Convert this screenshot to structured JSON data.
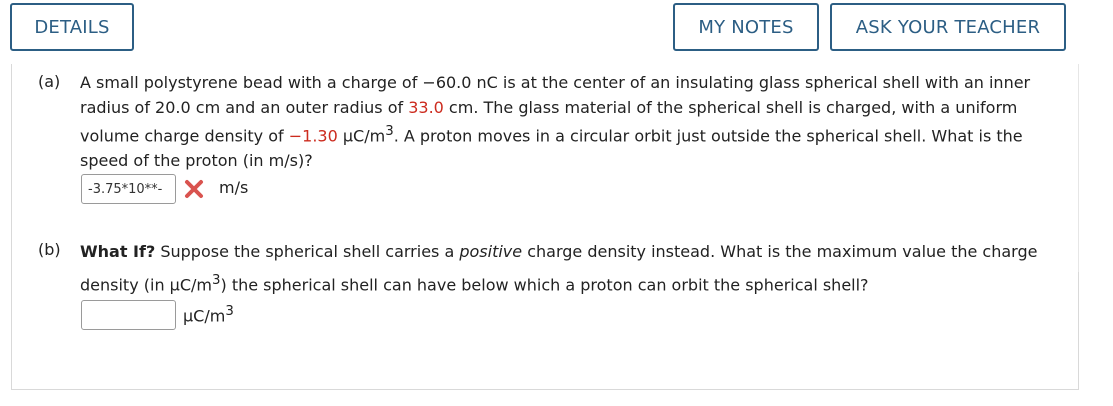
{
  "header": {
    "details_label": "DETAILS",
    "my_notes_label": "MY NOTES",
    "ask_teacher_label": "ASK YOUR TEACHER"
  },
  "part_a": {
    "label": "(a)",
    "text_1": "A small polystyrene bead with a charge of −60.0 nC is at the center of an insulating glass spherical shell with an inner radius of 20.0 cm and an outer radius of ",
    "outer_radius": "33.0",
    "text_2": " cm. The glass material of the spherical shell is charged, with a uniform volume charge density of ",
    "charge_density": "−1.30",
    "text_3": " µC/m",
    "exp_3": "3",
    "text_4": ". A proton moves in a circular orbit just outside the spherical shell. What is the speed of the proton (in m/s)?",
    "answer_value": "-3.75*10**-",
    "answer_status": "incorrect",
    "unit": "m/s"
  },
  "part_b": {
    "label": "(b)",
    "bold_prefix": "What If?",
    "text_1": " Suppose the spherical shell carries a ",
    "italic_word": "positive",
    "text_2": " charge density instead. What is the maximum value the charge density (in µC/m",
    "exp_3": "3",
    "text_3": ") the spherical shell can have below which a proton can orbit the spherical shell?",
    "answer_value": "",
    "unit_base": "µC/m",
    "unit_exp": "3"
  },
  "colors": {
    "accent": "#2c5e84",
    "highlight_red": "#cc2b1e",
    "incorrect_icon": "#d9534f"
  }
}
